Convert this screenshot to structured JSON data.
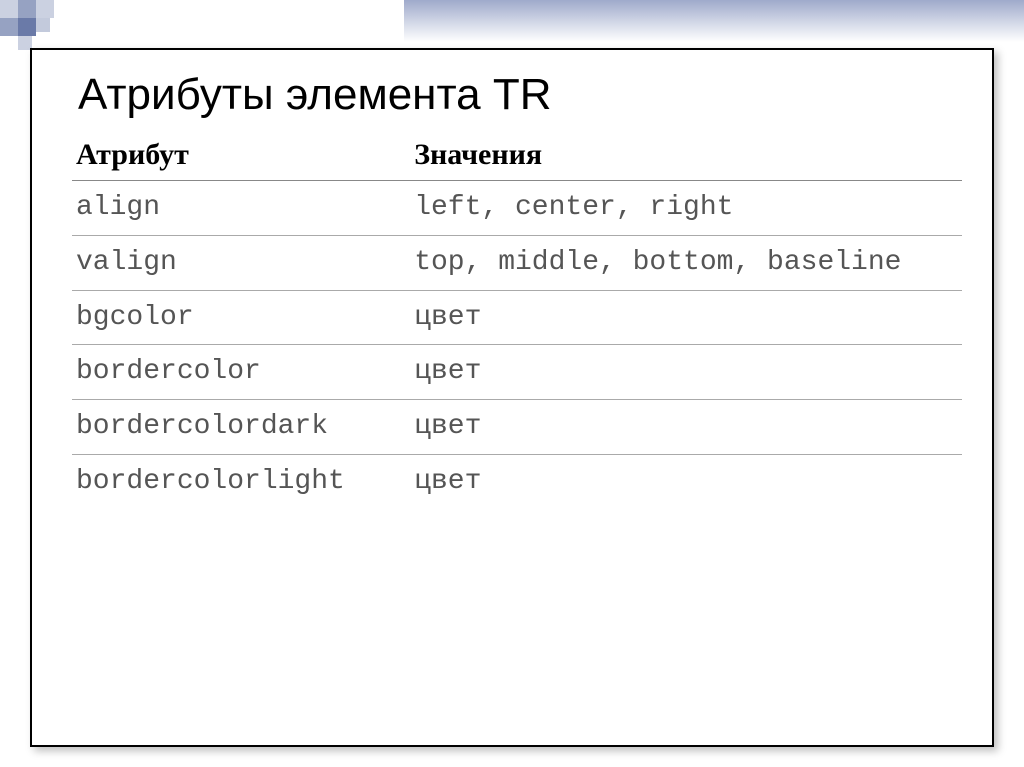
{
  "slide": {
    "title": "Атрибуты элемента TR",
    "headers": {
      "attr": "Атрибут",
      "values": "Значения"
    },
    "rows": [
      {
        "attr": "align",
        "values": "left, center, right"
      },
      {
        "attr": "valign",
        "values": "top, middle, bottom, baseline"
      },
      {
        "attr": "bgcolor",
        "values": "цвет"
      },
      {
        "attr": "bordercolor",
        "values": "цвет"
      },
      {
        "attr": "bordercolordark",
        "values": "цвет"
      },
      {
        "attr": "bordercolorlight",
        "values": "цвет"
      }
    ]
  }
}
